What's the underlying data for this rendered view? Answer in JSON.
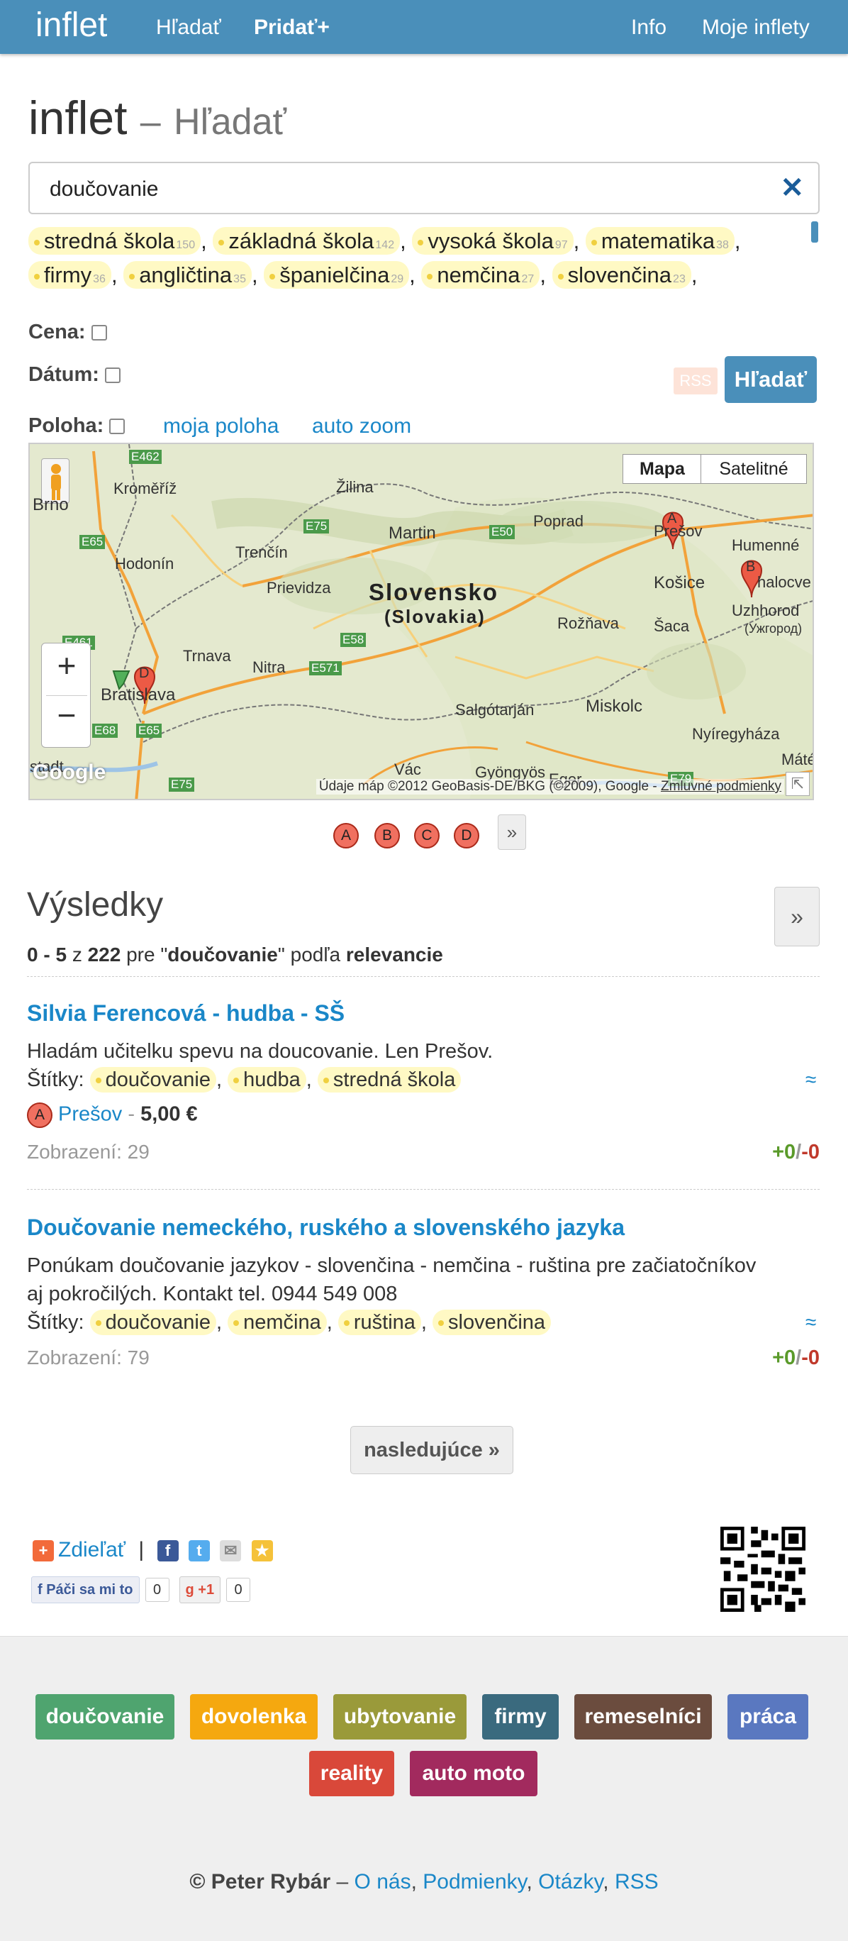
{
  "nav": {
    "brand": "inflet",
    "search": "Hľadať",
    "add": "Pridať+",
    "info": "Info",
    "my": "Moje inflety"
  },
  "heading": {
    "title": "inflet",
    "dash": "–",
    "subtitle": "Hľadať"
  },
  "search": {
    "value": "doučovanie",
    "clear_icon": "close-icon"
  },
  "suggested_tags": [
    {
      "label": "stredná škola",
      "count": "150"
    },
    {
      "label": "základná škola",
      "count": "142"
    },
    {
      "label": "vysoká škola",
      "count": "97"
    },
    {
      "label": "matematika",
      "count": "38"
    },
    {
      "label": "firmy",
      "count": "36"
    },
    {
      "label": "angličtina",
      "count": "35"
    },
    {
      "label": "španielčina",
      "count": "29"
    },
    {
      "label": "nemčina",
      "count": "27"
    },
    {
      "label": "slovenčina",
      "count": "23"
    }
  ],
  "filters": {
    "price": "Cena:",
    "date": "Dátum:",
    "location": "Poloha:",
    "my_location": "moja poloha",
    "auto_zoom": "auto zoom",
    "rss": "RSS",
    "search_btn": "Hľadať"
  },
  "map": {
    "type_map": "Mapa",
    "type_sat": "Satelitné",
    "country": "Slovensko",
    "country_local": "(Slovakia)",
    "attribution": "Údaje máp ©2012 GeoBasis-DE/BKG (©2009), Google -",
    "terms": "Zmluvné podmienky",
    "google": "Google",
    "zoom_in": "+",
    "zoom_out": "−",
    "places": {
      "brno": "Brno",
      "kromeriz": "Kroměříž",
      "zilina": "Žilina",
      "poprad": "Poprad",
      "presov": "Prešov",
      "humenne": "Humenné",
      "kosice": "Košice",
      "uzhhorod": "Uzhhorod",
      "uzhhorod_uk": "(Ужгород)",
      "hodonin": "Hodonín",
      "trencin": "Trenčín",
      "martin": "Martin",
      "prievidza": "Prievidza",
      "trnava": "Trnava",
      "nitra": "Nitra",
      "bratislava": "Bratislava",
      "salgotarjan": "Salgótarján",
      "miskolc": "Miskolc",
      "eger": "Eger",
      "nyiregyhaza": "Nyíregyháza",
      "rozhava": "Rožňava",
      "saca": "Šaca",
      "vac": "Vác",
      "gyongyos": "Gyöngyös",
      "mate": "Máté",
      "stadt": "stadt",
      "e462": "E462",
      "e65": "E65",
      "e75": "E75",
      "e50": "E50",
      "e58": "E58",
      "e571": "E571",
      "e68": "E68",
      "e79": "E79",
      "e461": "E461",
      "halocve": "halocve"
    }
  },
  "marker_strip": [
    "A",
    "B",
    "C",
    "D"
  ],
  "marker_more": "»",
  "results": {
    "title": "Výsledky",
    "more": "»",
    "summary": {
      "range": "0 - 5",
      "of": "z",
      "total": "222",
      "for": "pre",
      "q_open": "\"",
      "query": "doučovanie",
      "q_close": "\"",
      "by": "podľa",
      "order": "relevancie"
    },
    "items": [
      {
        "title": "Silvia Ferencová - hudba - SŠ",
        "desc": "Hladám učitelku spevu na doucovanie. Len Prešov.",
        "tags_label": "Štítky:",
        "tags": [
          "doučovanie",
          "hudba",
          "stredná škola"
        ],
        "marker": "A",
        "location": "Prešov",
        "sep": "-",
        "price": "5,00 €",
        "views": "Zobrazení: 29",
        "approx": "≈",
        "vote_plus": "+0",
        "vote_sep": "/",
        "vote_minus": "-0"
      },
      {
        "title": "Doučovanie nemeckého, ruského a slovenského jazyka",
        "desc": "Ponúkam doučovanie jazykov - slovenčina - nemčina - ruština pre začiatočníkov aj pokročilých. Kontakt tel. 0944 549 008",
        "tags_label": "Štítky:",
        "tags": [
          "doučovanie",
          "nemčina",
          "ruština",
          "slovenčina"
        ],
        "views": "Zobrazení: 79",
        "approx": "≈",
        "vote_plus": "+0",
        "vote_sep": "/",
        "vote_minus": "-0"
      }
    ],
    "next": "nasledujúce »"
  },
  "share": {
    "label": "Zdieľať",
    "sep": "|",
    "like": "Páči sa mi to",
    "like_count": "0",
    "gplus": "+1",
    "gplus_count": "0"
  },
  "categories": [
    {
      "label": "doučovanie",
      "color": "#4fa46f"
    },
    {
      "label": "dovolenka",
      "color": "#f5a80f"
    },
    {
      "label": "ubytovanie",
      "color": "#9a9a3a"
    },
    {
      "label": "firmy",
      "color": "#3a6a7e"
    },
    {
      "label": "remeselníci",
      "color": "#6b4c3e"
    },
    {
      "label": "práca",
      "color": "#5a78c0"
    },
    {
      "label": "reality",
      "color": "#d9483a"
    },
    {
      "label": "auto moto",
      "color": "#a22a5e"
    }
  ],
  "footer": {
    "copy": "© Peter Rybár",
    "dash": "–",
    "links": [
      "O nás",
      "Podmienky",
      "Otázky",
      "RSS"
    ],
    "comma": ","
  }
}
